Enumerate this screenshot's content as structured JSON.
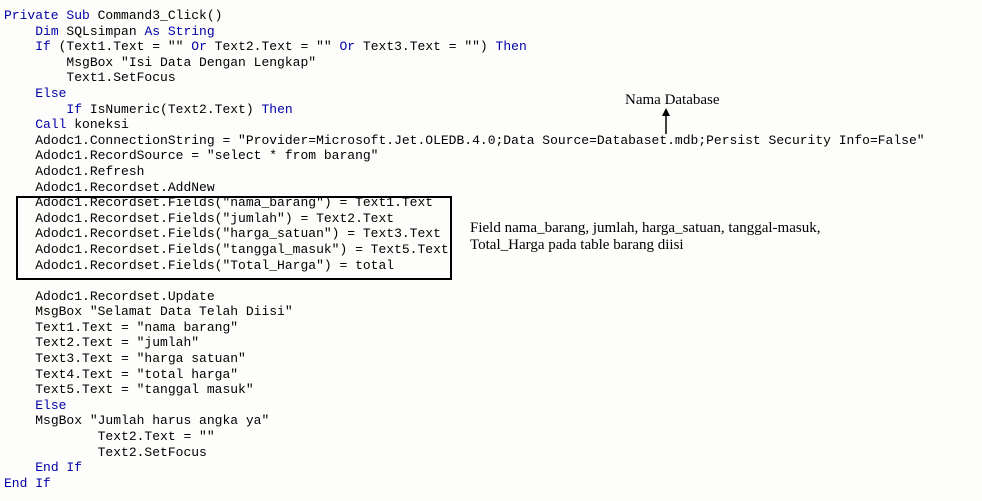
{
  "code": {
    "lines": [
      {
        "indent": 0,
        "tokens": [
          {
            "t": "Private Sub",
            "c": "kw"
          },
          {
            "t": " Command3_Click()",
            "c": "normal"
          }
        ]
      },
      {
        "indent": 1,
        "tokens": [
          {
            "t": "Dim",
            "c": "kw"
          },
          {
            "t": " SQLsimpan ",
            "c": "normal"
          },
          {
            "t": "As String",
            "c": "kw"
          }
        ]
      },
      {
        "indent": 1,
        "tokens": [
          {
            "t": "If",
            "c": "kw"
          },
          {
            "t": " (Text1.Text = \"\" ",
            "c": "normal"
          },
          {
            "t": "Or",
            "c": "kw"
          },
          {
            "t": " Text2.Text = \"\" ",
            "c": "normal"
          },
          {
            "t": "Or",
            "c": "kw"
          },
          {
            "t": " Text3.Text = \"\") ",
            "c": "normal"
          },
          {
            "t": "Then",
            "c": "kw"
          }
        ]
      },
      {
        "indent": 2,
        "tokens": [
          {
            "t": "MsgBox \"Isi Data Dengan Lengkap\"",
            "c": "normal"
          }
        ]
      },
      {
        "indent": 2,
        "tokens": [
          {
            "t": "Text1.SetFocus",
            "c": "normal"
          }
        ]
      },
      {
        "indent": 1,
        "tokens": [
          {
            "t": "Else",
            "c": "kw"
          }
        ]
      },
      {
        "indent": 2,
        "tokens": [
          {
            "t": "If",
            "c": "kw"
          },
          {
            "t": " IsNumeric(Text2.Text) ",
            "c": "normal"
          },
          {
            "t": "Then",
            "c": "kw"
          }
        ]
      },
      {
        "indent": 1,
        "tokens": [
          {
            "t": "Call",
            "c": "kw"
          },
          {
            "t": " koneksi",
            "c": "normal"
          }
        ]
      },
      {
        "indent": 1,
        "tokens": [
          {
            "t": "Adodc1.ConnectionString = \"Provider=Microsoft.Jet.OLEDB.4.0;Data Source=Databaset.mdb;Persist Security Info=False\"",
            "c": "normal"
          }
        ]
      },
      {
        "indent": 1,
        "tokens": [
          {
            "t": "Adodc1.RecordSource = \"select * from barang\"",
            "c": "normal"
          }
        ]
      },
      {
        "indent": 1,
        "tokens": [
          {
            "t": "Adodc1.Refresh",
            "c": "normal"
          }
        ]
      },
      {
        "indent": 1,
        "tokens": [
          {
            "t": "Adodc1.Recordset.AddNew",
            "c": "normal"
          }
        ]
      },
      {
        "indent": 1,
        "tokens": [
          {
            "t": "Adodc1.Recordset.Fields(\"nama_barang\") = Text1.Text",
            "c": "normal"
          }
        ]
      },
      {
        "indent": 1,
        "tokens": [
          {
            "t": "Adodc1.Recordset.Fields(\"jumlah\") = Text2.Text",
            "c": "normal"
          }
        ]
      },
      {
        "indent": 1,
        "tokens": [
          {
            "t": "Adodc1.Recordset.Fields(\"harga_satuan\") = Text3.Text",
            "c": "normal"
          }
        ]
      },
      {
        "indent": 1,
        "tokens": [
          {
            "t": "Adodc1.Recordset.Fields(\"tanggal_masuk\") = Text5.Text",
            "c": "normal"
          }
        ]
      },
      {
        "indent": 1,
        "tokens": [
          {
            "t": "Adodc1.Recordset.Fields(\"Total_Harga\") = total",
            "c": "normal"
          }
        ]
      },
      {
        "indent": 0,
        "tokens": [
          {
            "t": "",
            "c": "normal"
          }
        ]
      },
      {
        "indent": 1,
        "tokens": [
          {
            "t": "Adodc1.Recordset.Update",
            "c": "normal"
          }
        ]
      },
      {
        "indent": 1,
        "tokens": [
          {
            "t": "MsgBox \"Selamat Data Telah Diisi\"",
            "c": "normal"
          }
        ]
      },
      {
        "indent": 1,
        "tokens": [
          {
            "t": "Text1.Text = \"nama barang\"",
            "c": "normal"
          }
        ]
      },
      {
        "indent": 1,
        "tokens": [
          {
            "t": "Text2.Text = \"jumlah\"",
            "c": "normal"
          }
        ]
      },
      {
        "indent": 1,
        "tokens": [
          {
            "t": "Text3.Text = \"harga satuan\"",
            "c": "normal"
          }
        ]
      },
      {
        "indent": 1,
        "tokens": [
          {
            "t": "Text4.Text = \"total harga\"",
            "c": "normal"
          }
        ]
      },
      {
        "indent": 1,
        "tokens": [
          {
            "t": "Text5.Text = \"tanggal masuk\"",
            "c": "normal"
          }
        ]
      },
      {
        "indent": 1,
        "tokens": [
          {
            "t": "Else",
            "c": "kw"
          }
        ]
      },
      {
        "indent": 1,
        "tokens": [
          {
            "t": "MsgBox \"Jumlah harus angka ya\"",
            "c": "normal"
          }
        ]
      },
      {
        "indent": 3,
        "tokens": [
          {
            "t": "Text2.Text = \"\"",
            "c": "normal"
          }
        ]
      },
      {
        "indent": 3,
        "tokens": [
          {
            "t": "Text2.SetFocus",
            "c": "normal"
          }
        ]
      },
      {
        "indent": 1,
        "tokens": [
          {
            "t": "End If",
            "c": "kw"
          }
        ]
      },
      {
        "indent": 0,
        "tokens": [
          {
            "t": "End If",
            "c": "kw"
          }
        ]
      }
    ]
  },
  "annotations": {
    "database_label": "Nama Database",
    "fields_label": "Field nama_barang, jumlah, harga_satuan, tanggal-masuk, Total_Harga pada table barang diisi"
  }
}
